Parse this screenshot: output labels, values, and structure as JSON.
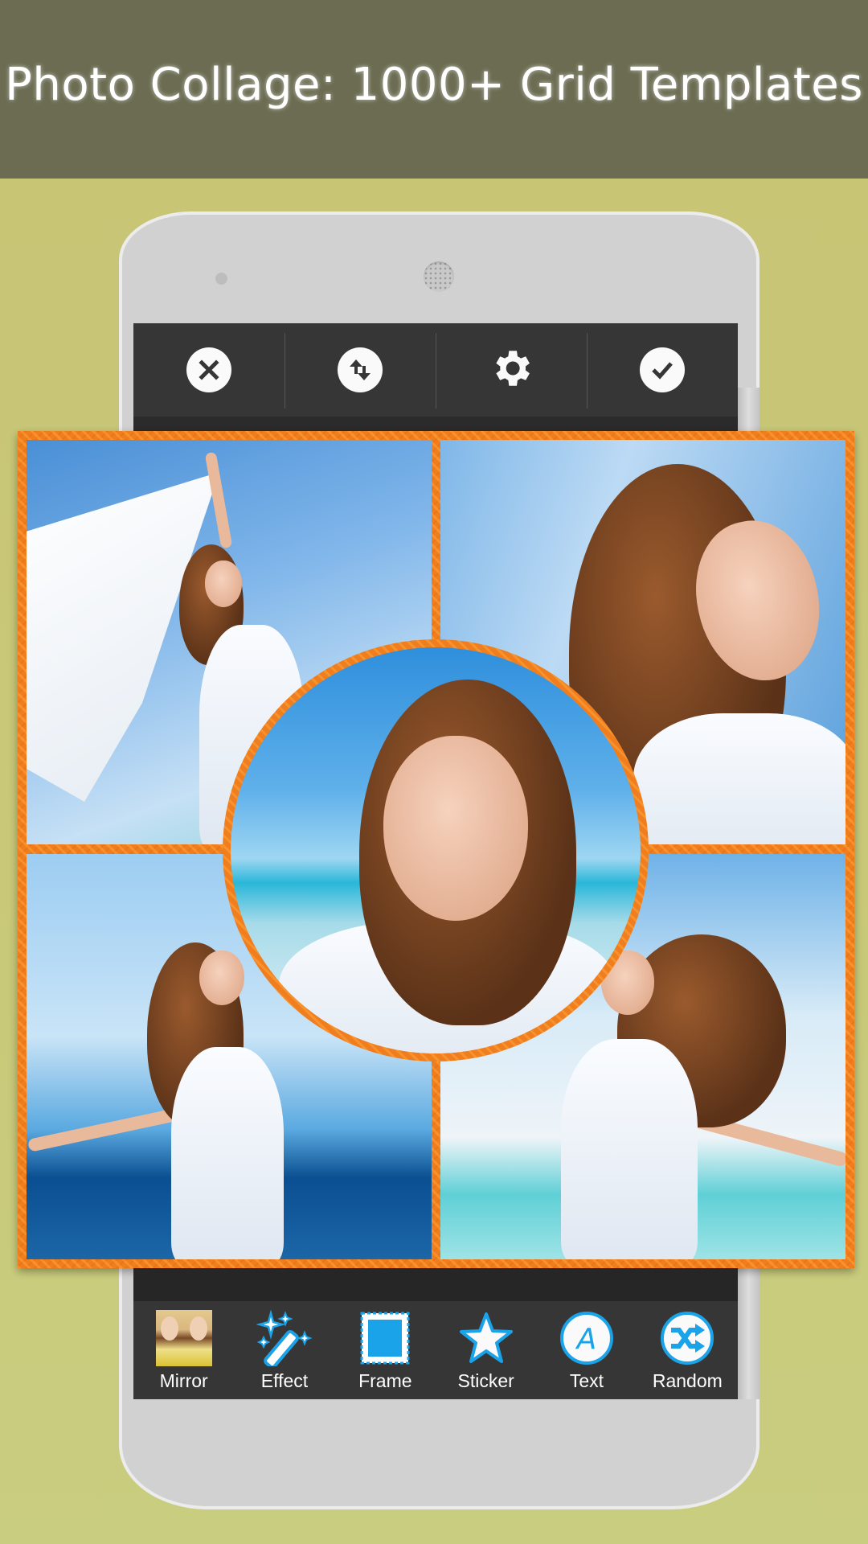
{
  "banner": {
    "title": "Photo Collage: 1000+ Grid Templates"
  },
  "colors": {
    "banner_bg": "#6b6c52",
    "page_bg": "#c9c878",
    "frame_orange": "#f07e1e",
    "toolbar_bg": "#363636",
    "accent_blue": "#1aa3e8"
  },
  "top_toolbar": {
    "buttons": [
      {
        "icon": "close-icon",
        "label": "Cancel"
      },
      {
        "icon": "swap-vertical-icon",
        "label": "Swap"
      },
      {
        "icon": "gear-icon",
        "label": "Settings"
      },
      {
        "icon": "check-icon",
        "label": "Done"
      }
    ]
  },
  "collage": {
    "layout": "2x2 grid with center circle",
    "cells": [
      {
        "position": "top-left",
        "description": "Girl holding white scarf against blue sky"
      },
      {
        "position": "top-right",
        "description": "Smiling girl with flowing hair"
      },
      {
        "position": "bottom-left",
        "description": "Girl with arms spread by the sea"
      },
      {
        "position": "bottom-right",
        "description": "Girl with arms spread, clouds and sea"
      },
      {
        "position": "center-circle",
        "description": "Close-up smiling girl at the beach"
      }
    ]
  },
  "bottom_toolbar": {
    "tools": [
      {
        "icon": "mirror-icon",
        "label": "Mirror"
      },
      {
        "icon": "magic-wand-icon",
        "label": "Effect"
      },
      {
        "icon": "frame-icon",
        "label": "Frame"
      },
      {
        "icon": "star-icon",
        "label": "Sticker"
      },
      {
        "icon": "text-icon",
        "label": "Text"
      },
      {
        "icon": "shuffle-icon",
        "label": "Random"
      }
    ]
  }
}
